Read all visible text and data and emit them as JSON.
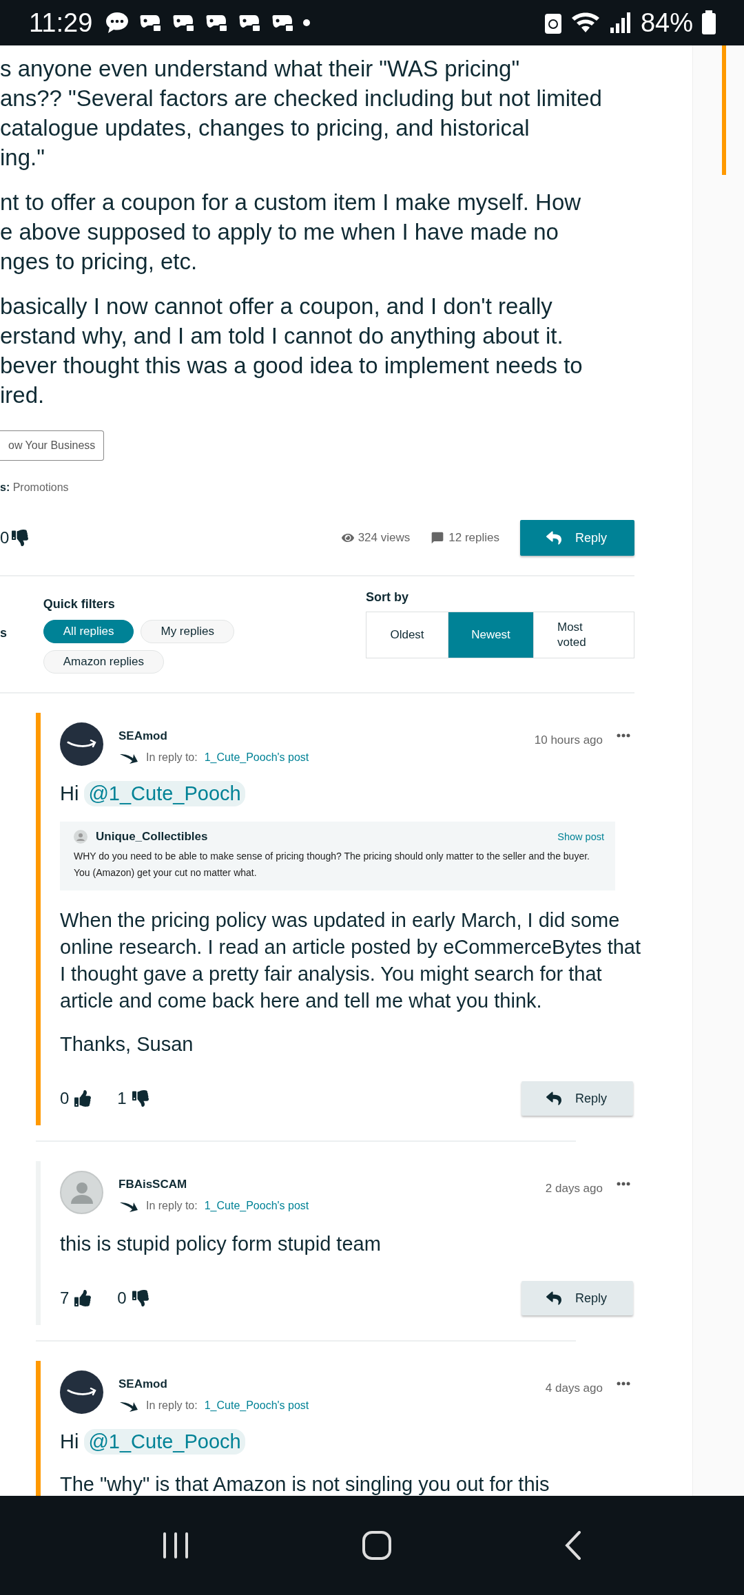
{
  "status_bar": {
    "time": "11:29",
    "battery": "84%"
  },
  "post": {
    "paragraphs": [
      [
        "s anyone even understand what their \"WAS pricing\"",
        "ans?? \"Several factors are checked including but not limited",
        "catalogue updates, changes to pricing, and historical",
        "ing.\""
      ],
      [
        "nt to offer a coupon for a custom item I make myself. How",
        "e above supposed to apply to me when I have made no",
        "nges to pricing, etc."
      ],
      [
        "basically I now cannot offer a coupon, and I don't really",
        "erstand why, and I am told I cannot do anything about it.",
        "bever thought this was a good idea to implement needs to",
        "ired."
      ]
    ],
    "tag": "ow Your Business",
    "labels_prefix": "s:",
    "labels_value": "Promotions",
    "dislikes": "0",
    "views": "324 views",
    "replies": "12 replies",
    "reply_button": "Reply"
  },
  "filters": {
    "cut_heading": "s",
    "title": "Quick filters",
    "items": [
      {
        "label": "All replies",
        "selected": true
      },
      {
        "label": "My replies",
        "selected": false
      },
      {
        "label": "Amazon replies",
        "selected": false
      }
    ],
    "sort_title": "Sort by",
    "sort_options": [
      {
        "label": "Oldest",
        "selected": false
      },
      {
        "label": "Newest",
        "selected": true
      },
      {
        "label": "Most voted",
        "selected": false
      }
    ]
  },
  "replies": [
    {
      "kind": "moderator",
      "author": "SEAmod",
      "time": "10 hours ago",
      "reply_prefix": "In reply to:",
      "reply_link": "1_Cute_Pooch's post",
      "greeting": "Hi",
      "mention": "@1_Cute_Pooch",
      "quote": {
        "author": "Unique_Collectibles",
        "action": "Show post",
        "text": "WHY do you need to be able to make sense of pricing though? The pricing should only matter to the seller and the buyer. You (Amazon) get your cut no matter what."
      },
      "paragraphs": [
        "When the pricing policy was updated in early March, I did some online research. I read an article posted by eCommerceBytes that I thought gave a pretty fair analysis. You might search for that article and come back here and tell me what you think.",
        "Thanks, Susan"
      ],
      "likes": "0",
      "dislikes": "1",
      "reply_button": "Reply"
    },
    {
      "kind": "user",
      "author": "FBAisSCAM",
      "time": "2 days ago",
      "reply_prefix": "In reply to:",
      "reply_link": "1_Cute_Pooch's post",
      "paragraphs": [
        "this is stupid policy form stupid team"
      ],
      "likes": "7",
      "dislikes": "0",
      "reply_button": "Reply"
    },
    {
      "kind": "moderator",
      "author": "SEAmod",
      "time": "4 days ago",
      "reply_prefix": "In reply to:",
      "reply_link": "1_Cute_Pooch's post",
      "greeting": "Hi",
      "mention": "@1_Cute_Pooch",
      "paragraphs": [
        "The \"why\" is that Amazon is not singling you out for this"
      ]
    }
  ]
}
